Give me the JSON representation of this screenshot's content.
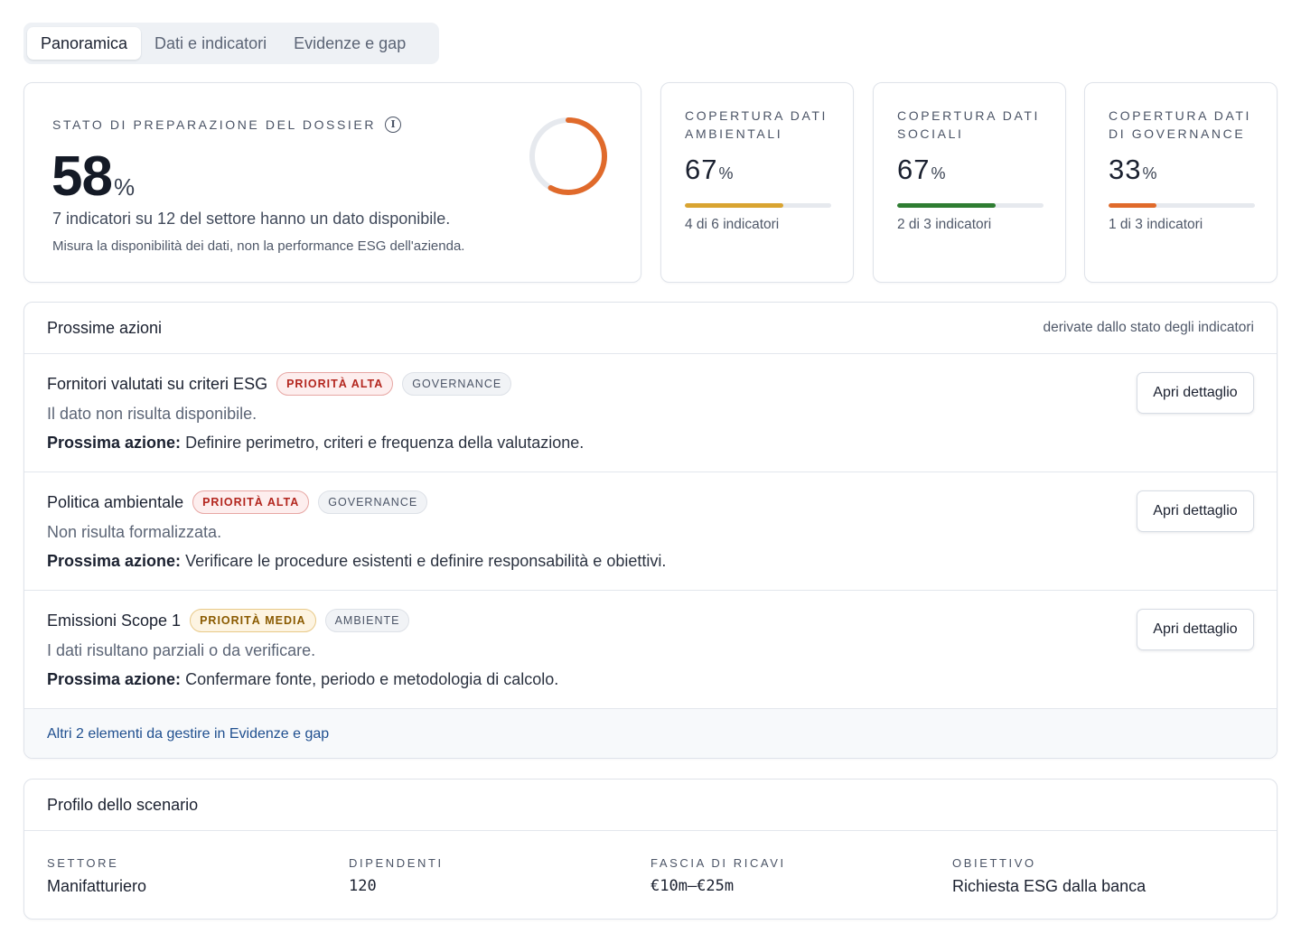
{
  "tabs": [
    {
      "label": "Panoramica",
      "active": true
    },
    {
      "label": "Dati e indicatori",
      "active": false
    },
    {
      "label": "Evidenze e gap",
      "active": false
    }
  ],
  "dossier": {
    "eyebrow": "STATO DI PREPARAZIONE DEL DOSSIER",
    "info_icon": "info-circle-icon",
    "value": "58",
    "unit": "%",
    "progress": 0.58,
    "ring_color": "#e06a2b",
    "line1": "7 indicatori su 12 del settore hanno un dato disponibile.",
    "line2": "Misura la disponibilità dei dati, non la performance ESG dell'azienda."
  },
  "coverage": [
    {
      "label": "COPERTURA DATI AMBIENTALI",
      "value": "67",
      "unit": "%",
      "fill": 0.67,
      "color": "#d9a431",
      "sub": "4 di 6 indicatori"
    },
    {
      "label": "COPERTURA DATI SOCIALI",
      "value": "67",
      "unit": "%",
      "fill": 0.67,
      "color": "#2e7d32",
      "sub": "2 di 3 indicatori"
    },
    {
      "label": "COPERTURA DATI DI GOVERNANCE",
      "value": "33",
      "unit": "%",
      "fill": 0.33,
      "color": "#e06a2b",
      "sub": "1 di 3 indicatori"
    }
  ],
  "actions": {
    "title": "Prossime azioni",
    "note": "derivate dallo stato degli indicatori",
    "items": [
      {
        "title": "Fornitori valutati su criteri ESG",
        "priority": "PRIORITÀ ALTA",
        "priority_level": "alta",
        "category": "GOVERNANCE",
        "desc": "Il dato non risulta disponibile.",
        "next_label": "Prossima azione:",
        "next_text": " Definire perimetro, criteri e frequenza della valutazione.",
        "button": "Apri dettaglio"
      },
      {
        "title": "Politica ambientale",
        "priority": "PRIORITÀ ALTA",
        "priority_level": "alta",
        "category": "GOVERNANCE",
        "desc": "Non risulta formalizzata.",
        "next_label": "Prossima azione:",
        "next_text": " Verificare le procedure esistenti e definire responsabilità e obiettivi.",
        "button": "Apri dettaglio"
      },
      {
        "title": "Emissioni Scope 1",
        "priority": "PRIORITÀ MEDIA",
        "priority_level": "media",
        "category": "AMBIENTE",
        "desc": "I dati risultano parziali o da verificare.",
        "next_label": "Prossima azione:",
        "next_text": " Confermare fonte, periodo e metodologia di calcolo.",
        "button": "Apri dettaglio"
      }
    ],
    "more_link": "Altri 2 elementi da gestire in Evidenze e gap"
  },
  "profile": {
    "title": "Profilo dello scenario",
    "fields": [
      {
        "label": "SETTORE",
        "value": "Manifatturiero",
        "mono": false
      },
      {
        "label": "DIPENDENTI",
        "value": "120",
        "mono": true
      },
      {
        "label": "FASCIA DI RICAVI",
        "value": "€10m–€25m",
        "mono": true
      },
      {
        "label": "OBIETTIVO",
        "value": "Richiesta ESG dalla banca",
        "mono": false
      }
    ]
  }
}
